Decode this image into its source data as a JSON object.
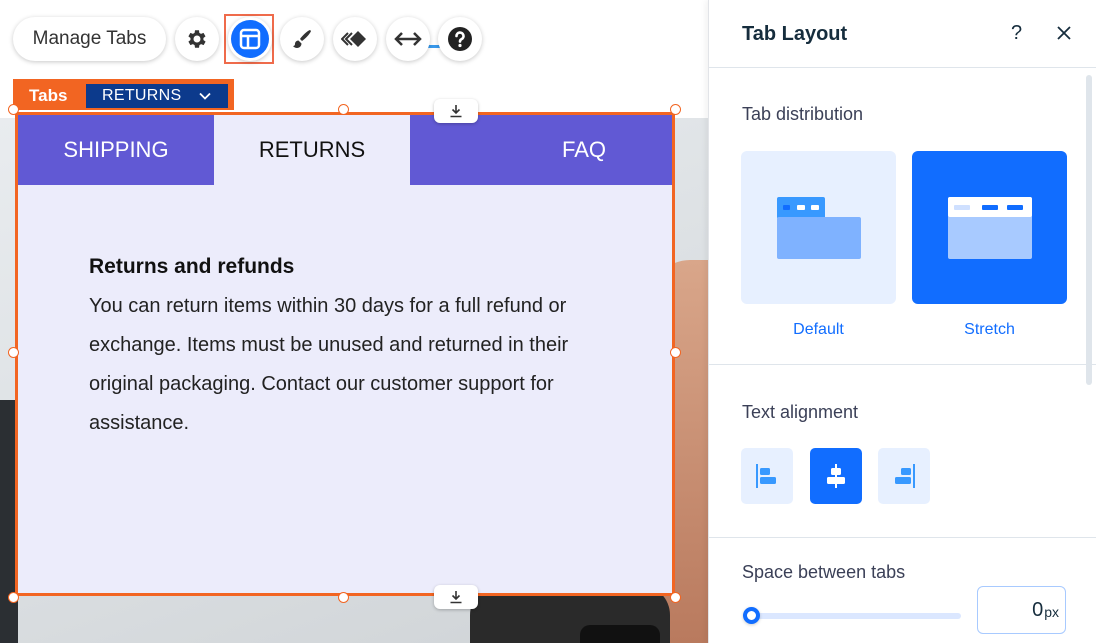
{
  "toolbar": {
    "manage_tabs_label": "Manage Tabs",
    "icons": [
      "gear-icon",
      "layout-icon",
      "brush-icon",
      "animation-icon",
      "stretch-icon",
      "help-icon"
    ]
  },
  "selection": {
    "tag_label": "Tabs",
    "selected_tab": "RETURNS"
  },
  "widget": {
    "tabs": [
      {
        "label": "SHIPPING",
        "active": false
      },
      {
        "label": "RETURNS",
        "active": true
      },
      {
        "label": "FAQ",
        "active": false
      }
    ],
    "content_title": "Returns and refunds",
    "content_body": "You can return items within 30 days for a full refund or exchange. Items must be unused and returned in their original packaging. Contact our customer support for assistance.",
    "colors": {
      "tab_bg": "#6159d4",
      "panel_bg": "#ececfb",
      "selection": "#f26522"
    }
  },
  "panel": {
    "title": "Tab Layout",
    "help": "?",
    "tab_distribution_label": "Tab distribution",
    "distribution_options": {
      "default": "Default",
      "stretch": "Stretch"
    },
    "selected_distribution": "Stretch",
    "text_alignment_label": "Text alignment",
    "selected_alignment": "center",
    "space_between_tabs_label": "Space between tabs",
    "space_value": "0",
    "space_unit": "px",
    "accent": "#116dff"
  }
}
